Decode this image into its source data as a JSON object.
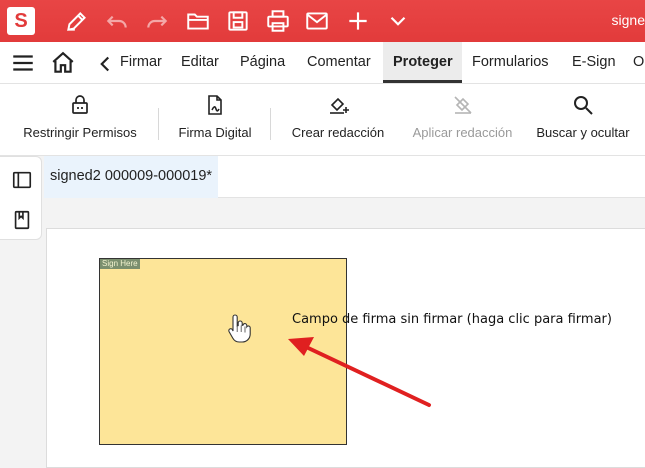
{
  "app": {
    "logo_letter": "S",
    "window_title": "signe"
  },
  "quick_toolbar": {
    "icons": [
      "pen-icon",
      "undo-icon",
      "redo-icon",
      "folder-icon",
      "save-icon",
      "print-icon",
      "mail-icon",
      "plus-icon",
      "chevron-down-icon"
    ]
  },
  "menubar": {
    "items": [
      "Firmar",
      "Editar",
      "Página",
      "Comentar",
      "Proteger",
      "Formularios",
      "E-Sign",
      "O"
    ],
    "active": "Proteger"
  },
  "ribbon": {
    "buttons": [
      {
        "label": "Restringir Permisos",
        "icon": "lock-icon",
        "enabled": true
      },
      {
        "label": "Firma Digital",
        "icon": "digital-signature-icon",
        "enabled": true
      },
      {
        "label": "Crear redacción",
        "icon": "redaction-create-icon",
        "enabled": true
      },
      {
        "label": "Aplicar redacción",
        "icon": "redaction-apply-icon",
        "enabled": false
      },
      {
        "label": "Buscar y ocultar",
        "icon": "search-icon",
        "enabled": true
      }
    ]
  },
  "document": {
    "tab_title": "signed2 000009-000019*",
    "signature_field_tag": "Sign Here",
    "tooltip": "Campo de firma sin firmar (haga clic para firmar)"
  },
  "colors": {
    "titlebar": "#e23b3b",
    "signature_field": "#fde598",
    "arrow": "#e02020"
  }
}
